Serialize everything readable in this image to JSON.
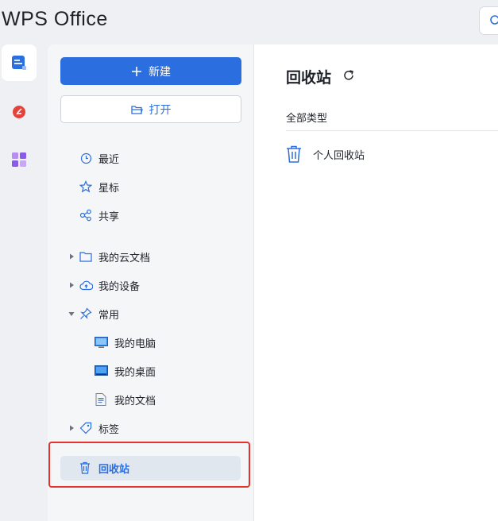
{
  "app": {
    "title": "WPS Office"
  },
  "sidebar": {
    "new_label": "新建",
    "open_label": "打开",
    "quick": [
      {
        "label": "最近",
        "icon": "clock-icon"
      },
      {
        "label": "星标",
        "icon": "star-icon"
      },
      {
        "label": "共享",
        "icon": "share-icon"
      }
    ],
    "locations": {
      "cloud": "我的云文档",
      "device": "我的设备",
      "common": "常用",
      "computer": "我的电脑",
      "desktop": "我的桌面",
      "documents": "我的文档",
      "tags": "标签",
      "trash": "回收站"
    }
  },
  "main": {
    "title": "回收站",
    "filter_label": "全部类型",
    "items": [
      {
        "label": "个人回收站",
        "icon": "trash-icon"
      }
    ]
  },
  "colors": {
    "accent": "#2a6ee0",
    "highlight": "#e5322d"
  }
}
